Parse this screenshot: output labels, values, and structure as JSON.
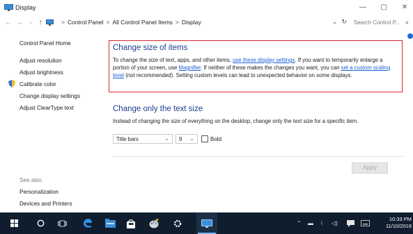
{
  "window": {
    "title": "Display",
    "minimize_glyph": "—",
    "maximize_glyph": "▢",
    "close_glyph": "✕"
  },
  "address": {
    "crumbs": [
      "Control Panel",
      "All Control Panel Items",
      "Display"
    ],
    "separator": ">",
    "search_placeholder": "Search Control P..."
  },
  "sidebar": {
    "home": "Control Panel Home",
    "links": [
      "Adjust resolution",
      "Adjust brightness",
      "Calibrate color",
      "Change display settings",
      "Adjust ClearType text"
    ],
    "see_also_title": "See also",
    "see_also": [
      "Personalization",
      "Devices and Printers"
    ]
  },
  "size_section": {
    "heading": "Change size of items",
    "text_1": "To change the size of text, apps, and other items, ",
    "link_1": "use these display settings",
    "text_2": ".  If you want to temporarily enlarge a portion of your screen, use ",
    "link_2": "Magnifier",
    "text_3": ".  If neither of these makes the changes you want, you can ",
    "link_3": "set a custom scaling level",
    "text_4": " (not recommended).  Setting custom levels can lead to unexpected behavior on some displays."
  },
  "text_section": {
    "heading": "Change only the text size",
    "description": "Instead of changing the size of everything on the desktop, change only the text size for a specific item.",
    "item_select": "Title bars",
    "size_select": "9",
    "bold_label": "Bold",
    "bold_checked": false
  },
  "apply_label": "Apply",
  "taskbar": {
    "time": "10:33 PM",
    "date": "11/10/2016"
  },
  "colors": {
    "heading": "#1a3f8f",
    "link": "#1a5fd6",
    "highlight_border": "#d6262f",
    "taskbar": "#0f1d2e"
  }
}
